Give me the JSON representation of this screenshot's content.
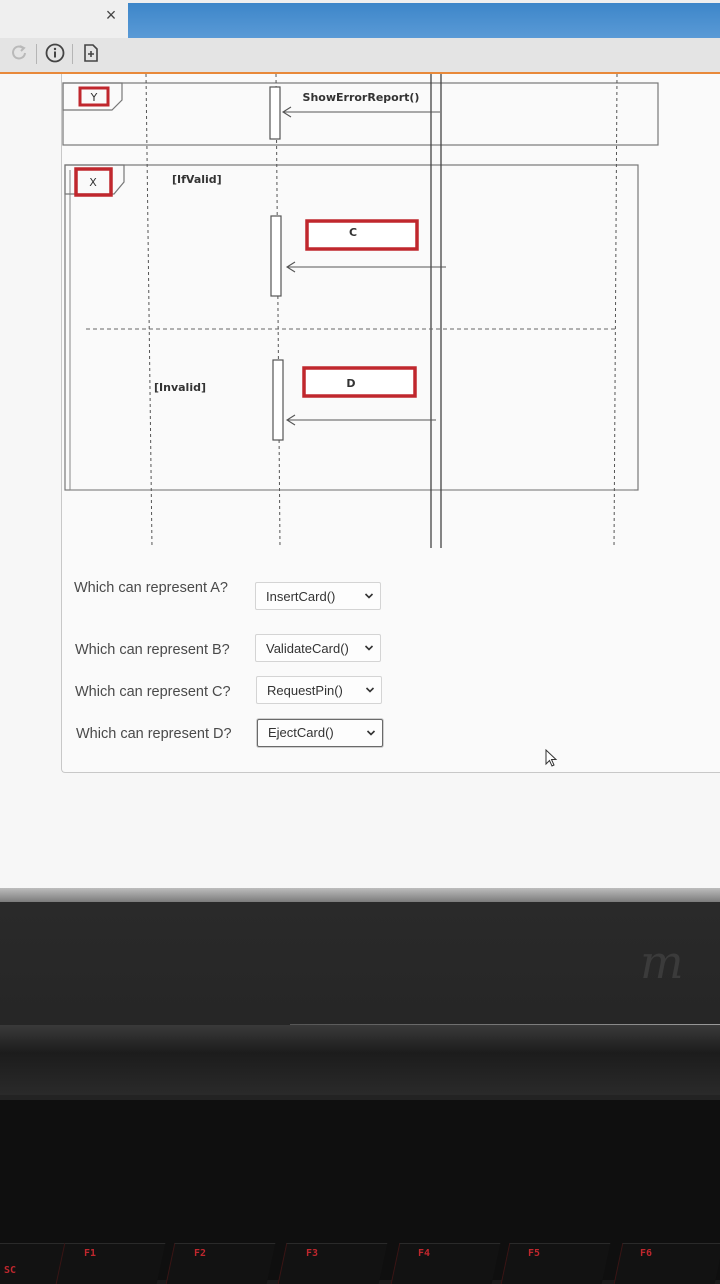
{
  "window": {
    "close_glyph": "×"
  },
  "toolbar": {
    "icons": [
      "refresh-icon",
      "info-icon",
      "add-document-icon"
    ]
  },
  "diagram": {
    "frame_y_tag": "Y",
    "frame_x_tag": "X",
    "show_error_report": "ShowErrorReport()",
    "guard_valid": "[IfValid]",
    "guard_invalid": "[Invalid]",
    "box_c": "C",
    "box_d": "D"
  },
  "questions": [
    {
      "label": "Which can represent A?",
      "selected": "InsertCard()"
    },
    {
      "label": "Which can represent B?",
      "selected": "ValidateCard()"
    },
    {
      "label": "Which can represent C?",
      "selected": "RequestPin()"
    },
    {
      "label": "Which can represent D?",
      "selected": "EjectCard()"
    }
  ],
  "keyboard": {
    "keys": [
      "SC",
      "F1",
      "F2",
      "F3",
      "F4",
      "F5",
      "F6"
    ]
  },
  "colors": {
    "accent_red": "#c0272d",
    "tab_blue": "#4a8fd0",
    "toolbar_orange": "#e8893a"
  }
}
